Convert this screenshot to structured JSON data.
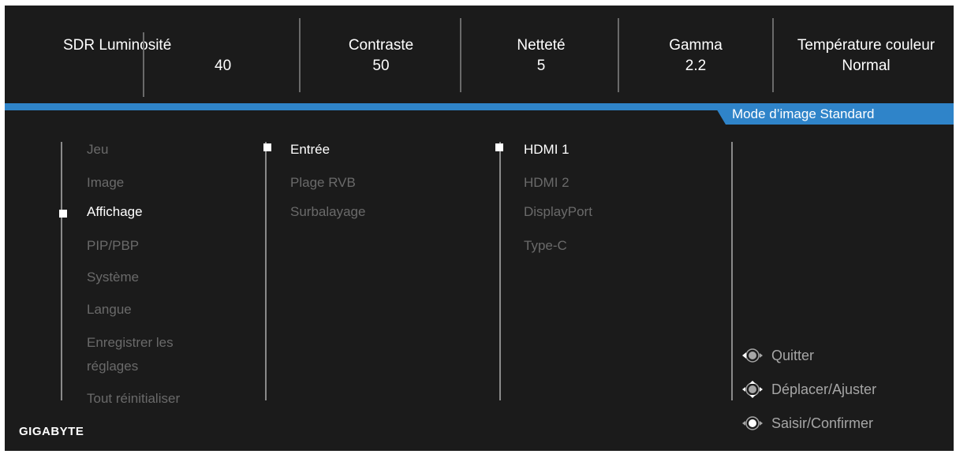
{
  "top_metrics": {
    "brightness": {
      "label": "SDR Luminosité",
      "value": "40"
    },
    "contrast": {
      "label": "Contraste",
      "value": "50"
    },
    "sharpness": {
      "label": "Netteté",
      "value": "5"
    },
    "gamma": {
      "label": "Gamma",
      "value": "2.2"
    },
    "color_temp": {
      "label": "Température couleur",
      "value": "Normal"
    }
  },
  "mode_banner": "Mode d’image Standard",
  "menu": {
    "items": [
      {
        "label": "Jeu"
      },
      {
        "label": "Image"
      },
      {
        "label": "Affichage"
      },
      {
        "label": "PIP/PBP"
      },
      {
        "label": "Système"
      },
      {
        "label": "Langue"
      },
      {
        "label": "Enregistrer les"
      },
      {
        "label": "réglages"
      },
      {
        "label": "Tout réinitialiser"
      }
    ],
    "active_index": 2
  },
  "submenu": {
    "items": [
      {
        "label": "Entrée"
      },
      {
        "label": "Plage RVB"
      },
      {
        "label": "Surbalayage"
      }
    ],
    "active_index": 0
  },
  "options": {
    "items": [
      {
        "label": "HDMI 1"
      },
      {
        "label": "HDMI 2"
      },
      {
        "label": "DisplayPort"
      },
      {
        "label": "Type-C"
      }
    ],
    "active_index": 0
  },
  "controls": {
    "quit": {
      "label": "Quitter",
      "icon": "joystick-left-icon"
    },
    "move": {
      "label": "Déplacer/Ajuster",
      "icon": "joystick-updown-icon"
    },
    "enter": {
      "label": "Saisir/Confirmer",
      "icon": "joystick-press-icon"
    }
  },
  "brand": "GIGABYTE",
  "colors": {
    "background": "#1b1b1b",
    "accent": "#2f84c9",
    "text_active": "#ffffff",
    "text_inactive": "#6a6a6a"
  }
}
